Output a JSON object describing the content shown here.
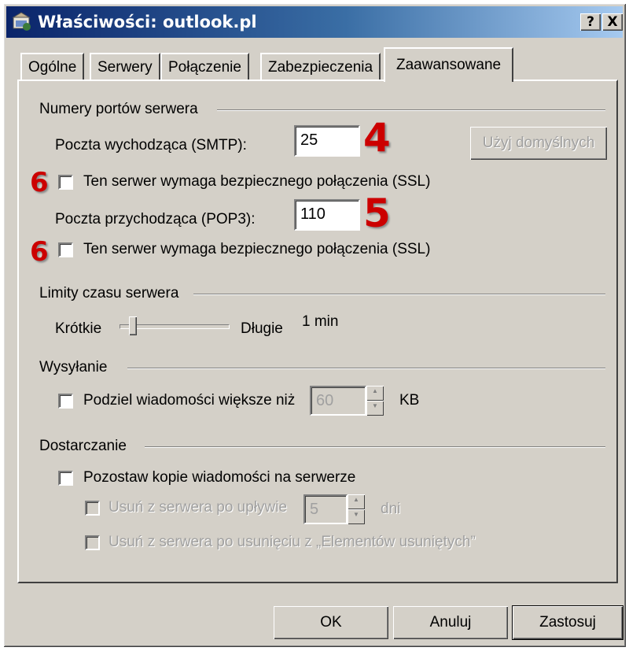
{
  "window": {
    "title": "Właściwości: outlook.pl",
    "help_button": "?",
    "close_button": "X"
  },
  "tabs": [
    {
      "label": "Ogólne"
    },
    {
      "label": "Serwery"
    },
    {
      "label": "Połączenie"
    },
    {
      "label": "Zabezpieczenia"
    },
    {
      "label": "Zaawansowane",
      "active": true
    }
  ],
  "ports": {
    "group_label": "Numery portów serwera",
    "smtp_label": "Poczta wychodząca (SMTP):",
    "smtp_value": "25",
    "smtp_ssl_label": "Ten serwer wymaga bezpiecznego połączenia (SSL)",
    "pop3_label": "Poczta przychodząca (POP3):",
    "pop3_value": "110",
    "pop3_ssl_label": "Ten serwer wymaga bezpiecznego połączenia (SSL)",
    "default_button": "Użyj domyślnych"
  },
  "annotations": {
    "smtp_number": "4",
    "pop3_number": "5",
    "ssl_number_1": "6",
    "ssl_number_2": "6",
    "color": "#cc0000"
  },
  "timeouts": {
    "group_label": "Limity czasu serwera",
    "short_label": "Krótkie",
    "long_label": "Długie",
    "value": "1 min",
    "slider_fraction": 0.1
  },
  "sending": {
    "group_label": "Wysyłanie",
    "split_label": "Podziel wiadomości większe niż",
    "split_value": "60",
    "unit": "KB"
  },
  "delivery": {
    "group_label": "Dostarczanie",
    "leave_copy_label": "Pozostaw kopie wiadomości na serwerze",
    "remove_after_label": "Usuń z serwera po upływie",
    "remove_after_value": "5",
    "days_unit": "dni",
    "remove_deleted_label": "Usuń z serwera po usunięciu z „Elementów usuniętych”"
  },
  "buttons": {
    "ok": "OK",
    "cancel": "Anuluj",
    "apply": "Zastosuj"
  },
  "colors": {
    "face": "#d4d0c8",
    "title_start": "#0a246a",
    "title_end": "#a6caf0"
  }
}
